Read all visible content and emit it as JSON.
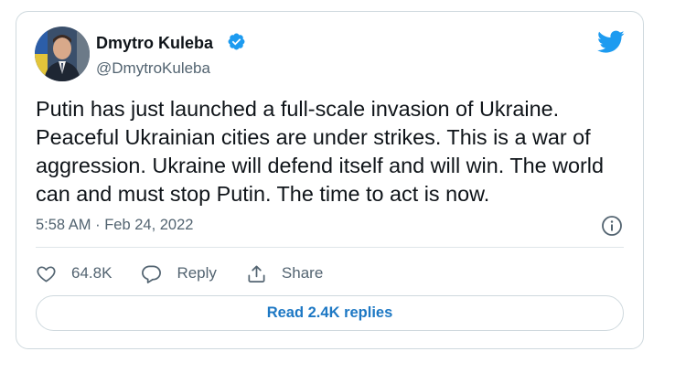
{
  "author": {
    "display_name": "Dmytro Kuleba",
    "handle": "@DmytroKuleba",
    "verified": true
  },
  "tweet": {
    "text": "Putin has just launched a full-scale invasion of Ukraine. Peaceful Ukrainian cities are under strikes. This is a war of aggression. Ukraine will defend itself and will win. The world can and must stop Putin. The time to act is now.",
    "timestamp": "5:58 AM · Feb 24, 2022"
  },
  "actions": {
    "like_count": "64.8K",
    "reply_label": "Reply",
    "share_label": "Share"
  },
  "read_replies_label": "Read 2.4K replies",
  "icons": {
    "brand": "twitter-bird-icon",
    "verified": "verified-badge-icon",
    "info": "info-icon",
    "like": "heart-icon",
    "reply": "reply-bubble-icon",
    "share": "share-icon"
  },
  "colors": {
    "brand_blue": "#1d9bf0",
    "link_blue": "#1d78c4",
    "text_primary": "#0f1419",
    "text_secondary": "#536471",
    "border": "#cfd9de"
  }
}
